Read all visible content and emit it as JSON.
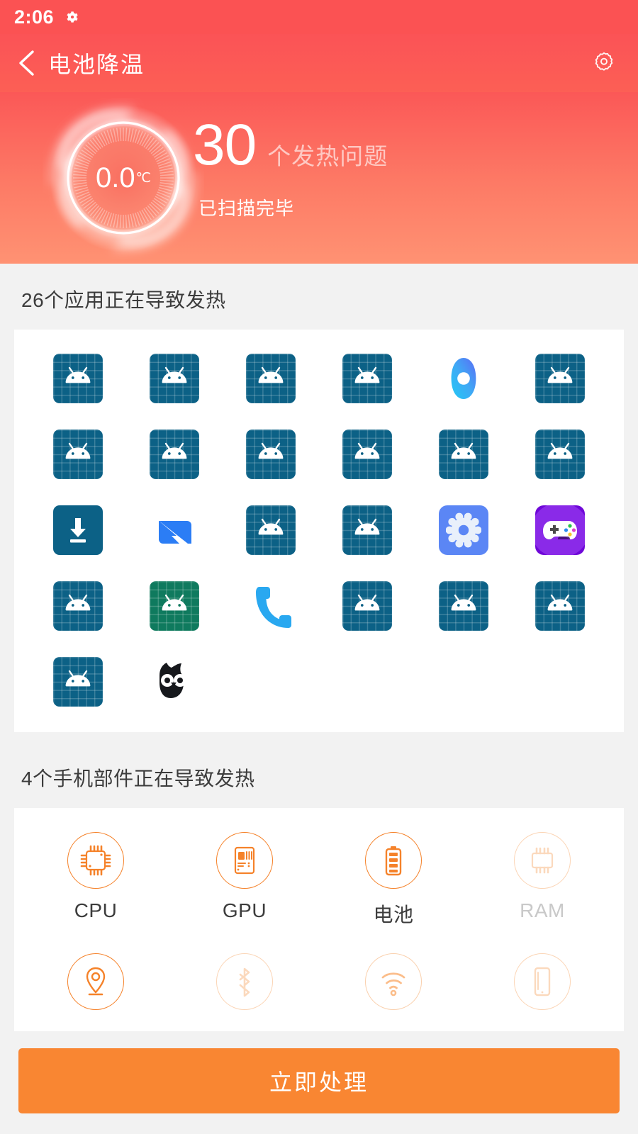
{
  "status_bar": {
    "time": "2:06",
    "icons": [
      {
        "name": "gear-icon"
      }
    ]
  },
  "title_bar": {
    "back_icon": "back-chevron-icon",
    "title": "电池降温",
    "settings_icon": "gear-icon"
  },
  "hero": {
    "temperature": "0.0",
    "temperature_unit": "℃",
    "issue_count": "30",
    "issue_label": "个发热问题",
    "scan_status": "已扫描完毕",
    "gradient_top": "#fb5857",
    "gradient_bottom": "#ff9273"
  },
  "apps_section": {
    "title": "26个应用正在导致发热",
    "count": 26,
    "items": [
      {
        "icon": "android-default-icon",
        "variant": "blue"
      },
      {
        "icon": "android-default-icon",
        "variant": "blue"
      },
      {
        "icon": "android-default-icon",
        "variant": "blue"
      },
      {
        "icon": "android-default-icon",
        "variant": "blue"
      },
      {
        "icon": "blue-ring-icon",
        "variant": "ring"
      },
      {
        "icon": "android-default-icon",
        "variant": "blue"
      },
      {
        "icon": "android-default-icon",
        "variant": "blue"
      },
      {
        "icon": "android-default-icon",
        "variant": "blue"
      },
      {
        "icon": "android-default-icon",
        "variant": "blue"
      },
      {
        "icon": "android-default-icon",
        "variant": "blue"
      },
      {
        "icon": "android-default-icon",
        "variant": "blue"
      },
      {
        "icon": "android-default-icon",
        "variant": "blue"
      },
      {
        "icon": "download-icon",
        "variant": "download"
      },
      {
        "icon": "lightning-bolt-icon",
        "variant": "flash"
      },
      {
        "icon": "android-default-icon",
        "variant": "blue"
      },
      {
        "icon": "android-default-icon",
        "variant": "blue"
      },
      {
        "icon": "settings-gear-icon",
        "variant": "settings"
      },
      {
        "icon": "game-controller-icon",
        "variant": "game"
      },
      {
        "icon": "android-default-icon",
        "variant": "blue"
      },
      {
        "icon": "android-default-icon",
        "variant": "green"
      },
      {
        "icon": "phone-handset-icon",
        "variant": "phone"
      },
      {
        "icon": "android-default-icon",
        "variant": "blue"
      },
      {
        "icon": "android-default-icon",
        "variant": "blue"
      },
      {
        "icon": "android-default-icon",
        "variant": "blue"
      },
      {
        "icon": "android-default-icon",
        "variant": "blue"
      },
      {
        "icon": "owl-icon",
        "variant": "owl"
      }
    ]
  },
  "components_section": {
    "title": "4个手机部件正在导致发热",
    "count": 4,
    "items": [
      {
        "label": "CPU",
        "icon": "cpu-chip-icon",
        "state": "active"
      },
      {
        "label": "GPU",
        "icon": "gpu-card-icon",
        "state": "active"
      },
      {
        "label": "电池",
        "icon": "battery-icon",
        "state": "active"
      },
      {
        "label": "RAM",
        "icon": "ram-chip-icon",
        "state": "inactive"
      },
      {
        "label": "",
        "icon": "location-pin-icon",
        "state": "active"
      },
      {
        "label": "",
        "icon": "bluetooth-icon",
        "state": "inactive"
      },
      {
        "label": "",
        "icon": "wifi-icon",
        "state": "mid"
      },
      {
        "label": "",
        "icon": "screen-icon",
        "state": "inactive"
      }
    ]
  },
  "bottom_bar": {
    "action_label": "立即处理",
    "action_color": "#f98632"
  }
}
